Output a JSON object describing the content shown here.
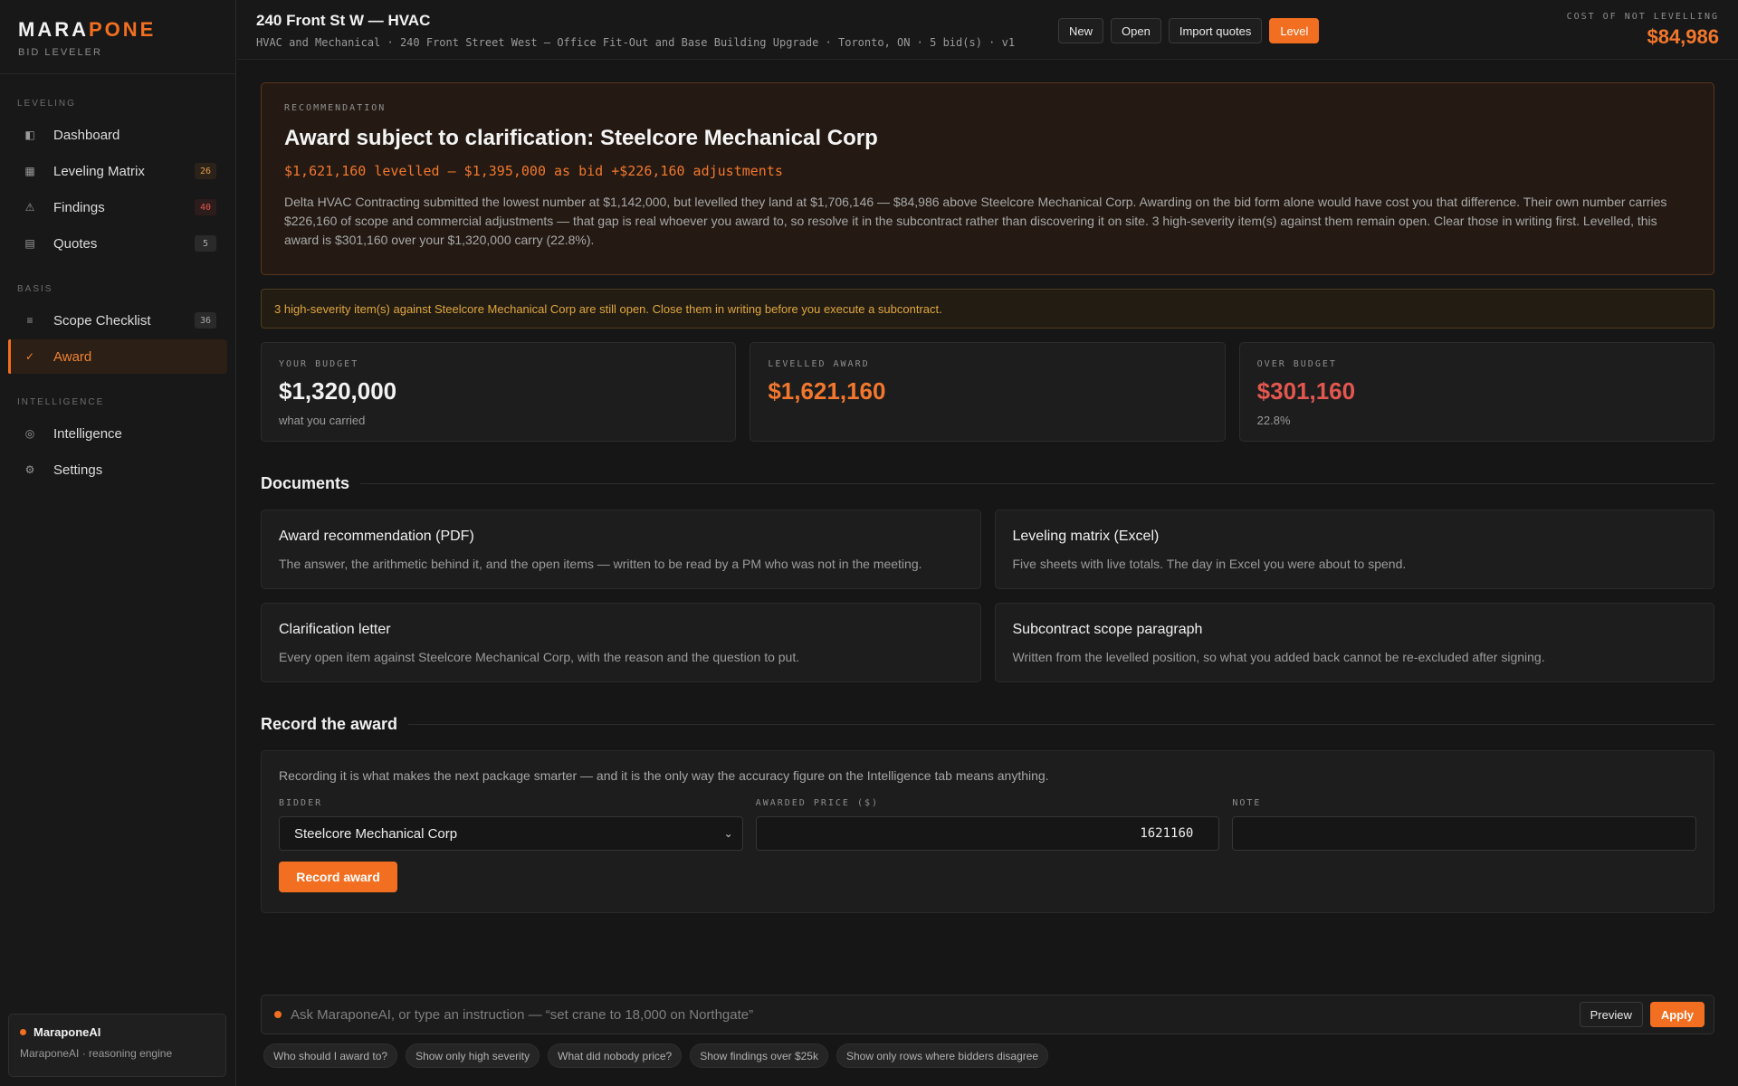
{
  "brand": {
    "name_a": "MARA",
    "name_b": "PONE",
    "subtitle": "BID LEVELER"
  },
  "sidebar": {
    "sections": [
      "LEVELING",
      "BASIS",
      "INTELLIGENCE"
    ],
    "items": [
      {
        "label": "Dashboard",
        "icon": "dashboard-icon",
        "badge": ""
      },
      {
        "label": "Leveling Matrix",
        "icon": "grid-icon",
        "badge": "26"
      },
      {
        "label": "Findings",
        "icon": "warning-icon",
        "badge": "40"
      },
      {
        "label": "Quotes",
        "icon": "document-icon",
        "badge": "5"
      },
      {
        "label": "Scope Checklist",
        "icon": "list-icon",
        "badge": "36"
      },
      {
        "label": "Award",
        "icon": "check-icon",
        "badge": ""
      },
      {
        "label": "Intelligence",
        "icon": "target-icon",
        "badge": ""
      },
      {
        "label": "Settings",
        "icon": "gear-icon",
        "badge": ""
      }
    ],
    "ai": {
      "title": "MaraponeAI",
      "subtitle": "MaraponeAI · reasoning engine"
    }
  },
  "header": {
    "title": "240 Front St W — HVAC",
    "subtitle": "HVAC and Mechanical · 240 Front Street West — Office Fit-Out and Base Building Upgrade · Toronto, ON · 5 bid(s) · v1",
    "actions": {
      "new": "New",
      "open": "Open",
      "import": "Import quotes",
      "level": "Level"
    },
    "cost_label": "COST OF NOT LEVELLING",
    "cost_value": "$84,986"
  },
  "recommendation": {
    "kicker": "RECOMMENDATION",
    "title": "Award subject to clarification: Steelcore Mechanical Corp",
    "figures": "$1,621,160 levelled — $1,395,000 as bid +$226,160 adjustments",
    "body": "Delta HVAC Contracting submitted the lowest number at $1,142,000, but levelled they land at $1,706,146 — $84,986 above Steelcore Mechanical Corp. Awarding on the bid form alone would have cost you that difference. Their own number carries $226,160 of scope and commercial adjustments — that gap is real whoever you award to, so resolve it in the subcontract rather than discovering it on site. 3 high-severity item(s) against them remain open. Clear those in writing first. Levelled, this award is $301,160 over your $1,320,000 carry (22.8%)."
  },
  "alert": "3 high-severity item(s) against Steelcore Mechanical Corp are still open. Close them in writing before you execute a subcontract.",
  "stats": [
    {
      "label": "YOUR BUDGET",
      "value": "$1,320,000",
      "sub": "what you carried",
      "color": "#f2f2f2"
    },
    {
      "label": "LEVELLED AWARD",
      "value": "$1,621,160",
      "sub": "",
      "color": "#f2772d"
    },
    {
      "label": "OVER BUDGET",
      "value": "$301,160",
      "sub": "22.8%",
      "color": "#e2574f"
    }
  ],
  "documents": {
    "heading": "Documents",
    "items": [
      {
        "title": "Award recommendation (PDF)",
        "desc": "The answer, the arithmetic behind it, and the open items — written to be read by a PM who was not in the meeting."
      },
      {
        "title": "Leveling matrix (Excel)",
        "desc": "Five sheets with live totals. The day in Excel you were about to spend."
      },
      {
        "title": "Clarification letter",
        "desc": "Every open item against Steelcore Mechanical Corp, with the reason and the question to put."
      },
      {
        "title": "Subcontract scope paragraph",
        "desc": "Written from the levelled position, so what you added back cannot be re-excluded after signing."
      }
    ]
  },
  "record": {
    "heading": "Record the award",
    "desc": "Recording it is what makes the next package smarter — and it is the only way the accuracy figure on the Intelligence tab means anything.",
    "bidder_label": "BIDDER",
    "bidder_value": "Steelcore Mechanical Corp",
    "price_label": "AWARDED PRICE ($)",
    "price_value": "1621160",
    "note_label": "NOTE",
    "note_value": "",
    "button": "Record award"
  },
  "ask": {
    "placeholder": "Ask MaraponeAI, or type an instruction — “set crane to 18,000 on Northgate”",
    "preview": "Preview",
    "apply": "Apply",
    "chips": [
      "Who should I award to?",
      "Show only high severity",
      "What did nobody price?",
      "Show findings over $25k",
      "Show only rows where bidders disagree"
    ]
  }
}
